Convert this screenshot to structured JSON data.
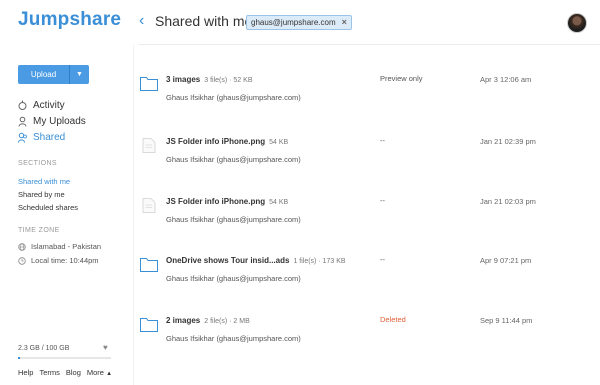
{
  "app": {
    "logo": "Jumpshare"
  },
  "header": {
    "back_icon": "chevron-left-icon",
    "title": "Shared with me",
    "filter_chip": "ghaus@jumpshare.com",
    "filter_chip_close": "×"
  },
  "sidebar": {
    "upload_label": "Upload",
    "upload_caret": "▼",
    "nav": [
      {
        "label": "Activity",
        "icon": "activity-icon"
      },
      {
        "label": "My Uploads",
        "icon": "user-icon"
      },
      {
        "label": "Shared",
        "icon": "shared-icon"
      }
    ],
    "sections_heading": "SECTIONS",
    "sections": [
      "Shared with me",
      "Shared by me",
      "Scheduled shares"
    ],
    "timezone_heading": "TIME ZONE",
    "timezone_location": "Islamabad - Pakistan",
    "timezone_local": "Local time: 10:44pm",
    "storage_label": "2.3 GB / 100 GB",
    "storage_fraction": 0.023,
    "storage_icon": "heart-icon",
    "footer": {
      "help": "Help",
      "terms": "Terms",
      "blog": "Blog",
      "more": "More",
      "more_caret": "▲"
    }
  },
  "colors": {
    "accent": "#3a8fd6",
    "deleted": "#e0623a",
    "button": "#4a9be3"
  },
  "rows": [
    {
      "icon": "folder-icon",
      "name": "3 images",
      "meta": "3 file(s) · 52 KB",
      "owner": "Ghaus Ifsikhar (ghaus@jumpshare.com)",
      "status": "Preview only",
      "date": "Apr 3 12:06 am"
    },
    {
      "icon": "file-icon",
      "name": "JS Folder info iPhone.png",
      "meta": "54 KB",
      "owner": "Ghaus Ifsikhar (ghaus@jumpshare.com)",
      "status": "--",
      "date": "Jan 21 02:39 pm"
    },
    {
      "icon": "file-icon",
      "name": "JS Folder info iPhone.png",
      "meta": "54 KB",
      "owner": "Ghaus Ifsikhar (ghaus@jumpshare.com)",
      "status": "--",
      "date": "Jan 21 02:03 pm"
    },
    {
      "icon": "folder-icon",
      "name": "OneDrive shows Tour insid...ads",
      "meta": "1 file(s) · 173 KB",
      "owner": "Ghaus Ifsikhar (ghaus@jumpshare.com)",
      "status": "--",
      "date": "Apr 9 07:21 pm"
    },
    {
      "icon": "folder-icon",
      "name": "2 images",
      "meta": "2 file(s) · 2 MB",
      "owner": "Ghaus Ifsikhar (ghaus@jumpshare.com)",
      "status": "Deleted",
      "date": "Sep 9 11:44 pm"
    }
  ]
}
